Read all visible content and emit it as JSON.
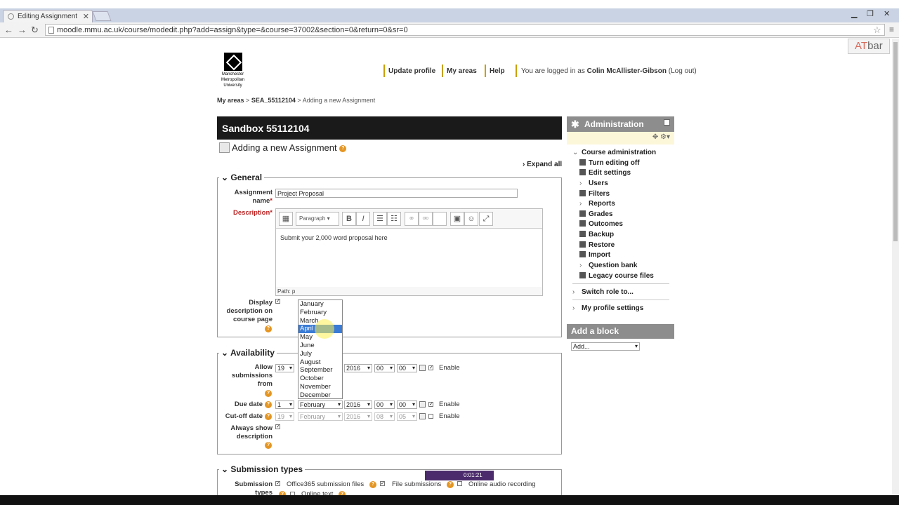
{
  "browser": {
    "tab_title": "Editing Assignment",
    "url": "moodle.mmu.ac.uk/course/modedit.php?add=assign&type=&course=37002&section=0&return=0&sr=0",
    "atbar_at": "AT",
    "atbar_bar": "bar"
  },
  "site": {
    "logo_lines": [
      "Manchester",
      "Metropolitan",
      "University"
    ],
    "nav": [
      "Update profile",
      "My areas",
      "Help"
    ],
    "login_prefix": "You are logged in as",
    "login_user": "Colin McAllister-Gibson",
    "logout": "(Log out)"
  },
  "breadcrumb": {
    "home": "My areas",
    "sep1": ">",
    "course": "SEA_55112104",
    "sep2": ">",
    "current": "Adding a new Assignment"
  },
  "page": {
    "header": "Sandbox 55112104",
    "title": "Adding a new Assignment",
    "expand_all": "Expand all"
  },
  "general": {
    "legend": "General",
    "name_label": "Assignment name",
    "name_value": "Project Proposal",
    "desc_label": "Description",
    "editor_format": "Paragraph",
    "editor_content": "Submit your 2,000 word proposal here",
    "editor_path": "Path: p",
    "display_label": "Display description on course page"
  },
  "availability": {
    "legend": "Availability",
    "allow_label": "Allow submissions from",
    "due_label": "Due date",
    "cutoff_label": "Cut-off date",
    "always_label": "Always show description",
    "enable": "Enable",
    "allow": {
      "day": "19",
      "year": "2016",
      "hour": "00",
      "min": "00"
    },
    "due": {
      "day": "1",
      "month": "February",
      "year": "2016",
      "hour": "00",
      "min": "00"
    },
    "cutoff": {
      "day": "19",
      "month": "February",
      "year": "2016",
      "hour": "08",
      "min": "05"
    }
  },
  "months": [
    "January",
    "February",
    "March",
    "April",
    "May",
    "June",
    "July",
    "August",
    "September",
    "October",
    "November",
    "December"
  ],
  "month_highlighted": "April",
  "submission": {
    "legend": "Submission types",
    "label": "Submission types",
    "opt1": "Office365 submission files",
    "opt2": "File submissions",
    "opt3": "Online audio recording",
    "opt4": "Online text"
  },
  "admin": {
    "title": "Administration",
    "course_admin": "Course administration",
    "items": [
      "Turn editing off",
      "Edit settings",
      "Users",
      "Filters",
      "Reports",
      "Grades",
      "Outcomes",
      "Backup",
      "Restore",
      "Import",
      "Question bank",
      "Legacy course files"
    ],
    "switch_role": "Switch role to...",
    "profile": "My profile settings"
  },
  "add_block": {
    "title": "Add a block",
    "select": "Add..."
  },
  "video": {
    "time": "0:01:21"
  },
  "colors": {
    "header_bg": "#1a1a1a",
    "block_header": "#8d8d8d",
    "help": "#e49522",
    "highlight": "#3a7bd5"
  }
}
